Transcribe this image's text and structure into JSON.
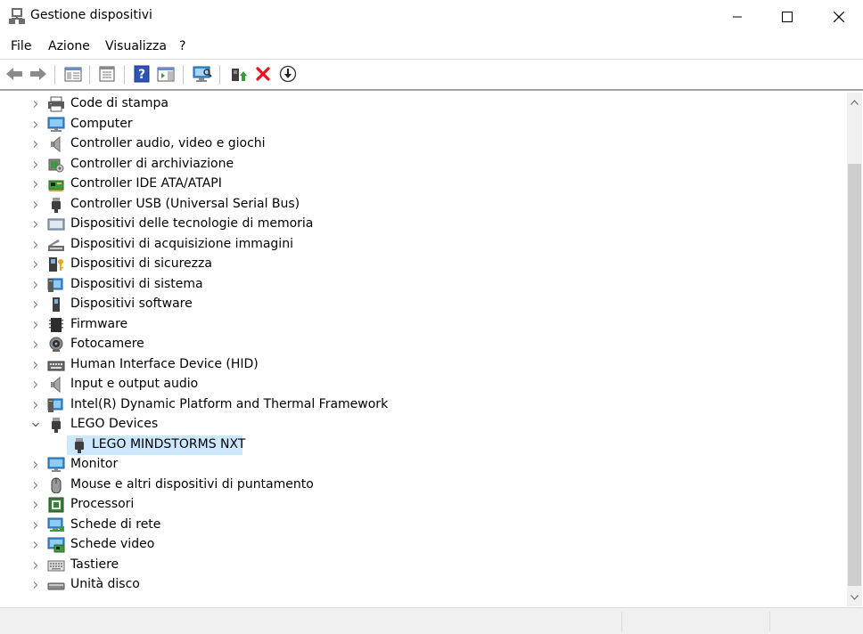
{
  "window": {
    "title": "Gestione dispositivi",
    "controls": {
      "minimize_icon": "minimize-icon",
      "maximize_icon": "maximize-icon",
      "close_icon": "close-icon"
    }
  },
  "menu": [
    "File",
    "Azione",
    "Visualizza",
    "?"
  ],
  "toolbar": {
    "buttons": [
      "back-arrow-icon",
      "forward-arrow-icon",
      "show-hide-console-tree-icon",
      "properties-icon",
      "help-icon",
      "action-pane-icon",
      "scan-hardware-icon",
      "update-driver-icon",
      "uninstall-device-icon",
      "disable-device-icon"
    ],
    "accent_red": "#e81123"
  },
  "tree": {
    "items": [
      {
        "label": "Code di stampa",
        "icon": "printer-icon",
        "expanded": false
      },
      {
        "label": "Computer",
        "icon": "computer-icon",
        "expanded": false
      },
      {
        "label": "Controller audio, video e giochi",
        "icon": "speaker-icon",
        "expanded": false
      },
      {
        "label": "Controller di archiviazione",
        "icon": "storage-controller-icon",
        "expanded": false
      },
      {
        "label": "Controller IDE ATA/ATAPI",
        "icon": "ide-controller-icon",
        "expanded": false
      },
      {
        "label": "Controller USB (Universal Serial Bus)",
        "icon": "usb-icon",
        "expanded": false
      },
      {
        "label": "Dispositivi delle tecnologie di memoria",
        "icon": "memory-device-icon",
        "expanded": false
      },
      {
        "label": "Dispositivi di acquisizione immagini",
        "icon": "scanner-icon",
        "expanded": false
      },
      {
        "label": "Dispositivi di sicurezza",
        "icon": "security-key-icon",
        "expanded": false
      },
      {
        "label": "Dispositivi di sistema",
        "icon": "system-device-icon",
        "expanded": false
      },
      {
        "label": "Dispositivi software",
        "icon": "software-device-icon",
        "expanded": false
      },
      {
        "label": "Firmware",
        "icon": "firmware-chip-icon",
        "expanded": false
      },
      {
        "label": "Fotocamere",
        "icon": "camera-icon",
        "expanded": false
      },
      {
        "label": "Human Interface Device (HID)",
        "icon": "hid-keyboard-icon",
        "expanded": false
      },
      {
        "label": "Input e output audio",
        "icon": "speaker-icon",
        "expanded": false
      },
      {
        "label": "Intel(R) Dynamic Platform and Thermal Framework",
        "icon": "system-device-icon",
        "expanded": false
      },
      {
        "label": "LEGO Devices",
        "icon": "usb-icon",
        "expanded": true
      },
      {
        "label": "LEGO MINDSTORMS NXT",
        "icon": "usb-icon",
        "child": true,
        "selected": true
      },
      {
        "label": "Monitor",
        "icon": "monitor-icon",
        "expanded": false
      },
      {
        "label": "Mouse e altri dispositivi di puntamento",
        "icon": "mouse-icon",
        "expanded": false
      },
      {
        "label": "Processori",
        "icon": "processor-icon",
        "expanded": false
      },
      {
        "label": "Schede di rete",
        "icon": "network-adapter-icon",
        "expanded": false
      },
      {
        "label": "Schede video",
        "icon": "display-adapter-icon",
        "expanded": false
      },
      {
        "label": "Tastiere",
        "icon": "keyboard-icon",
        "expanded": false
      },
      {
        "label": "Unità disco",
        "icon": "disk-drive-icon",
        "expanded": false
      }
    ]
  },
  "colors": {
    "selection": "#cce8ff",
    "monitor_blue": "#3a8fd6",
    "green": "#3d9a3d"
  }
}
